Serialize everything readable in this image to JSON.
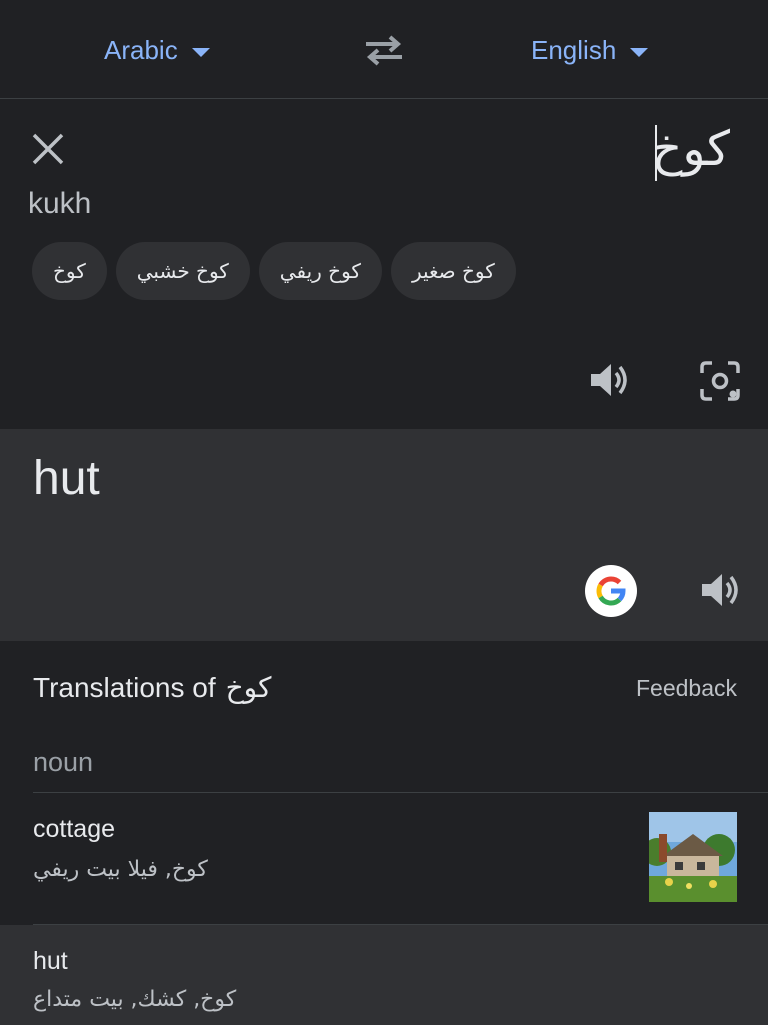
{
  "header": {
    "source_language": "Arabic",
    "target_language": "English"
  },
  "source": {
    "text": "كوخ",
    "transliteration": "kukh",
    "suggestions": [
      "كوخ",
      "كوخ خشبي",
      "كوخ ريفي",
      "كوخ صغير"
    ]
  },
  "target": {
    "text": "hut"
  },
  "details": {
    "title_prefix": "Translations of",
    "title_word": "كوخ",
    "feedback_label": "Feedback",
    "part_of_speech": "noun",
    "entries": [
      {
        "word": "cottage",
        "synonyms": "كوخ, فيلا بيت ريفي"
      },
      {
        "word": "hut",
        "synonyms": "كوخ, كشك, بيت متداع"
      }
    ]
  },
  "colors": {
    "background": "#202124",
    "surface": "#303134",
    "accent": "#8ab4f8",
    "text": "#e8eaed"
  },
  "icons": [
    "swap-arrows-icon",
    "close-icon",
    "speaker-icon",
    "camera-icon",
    "google-logo-icon",
    "speaker-icon"
  ]
}
